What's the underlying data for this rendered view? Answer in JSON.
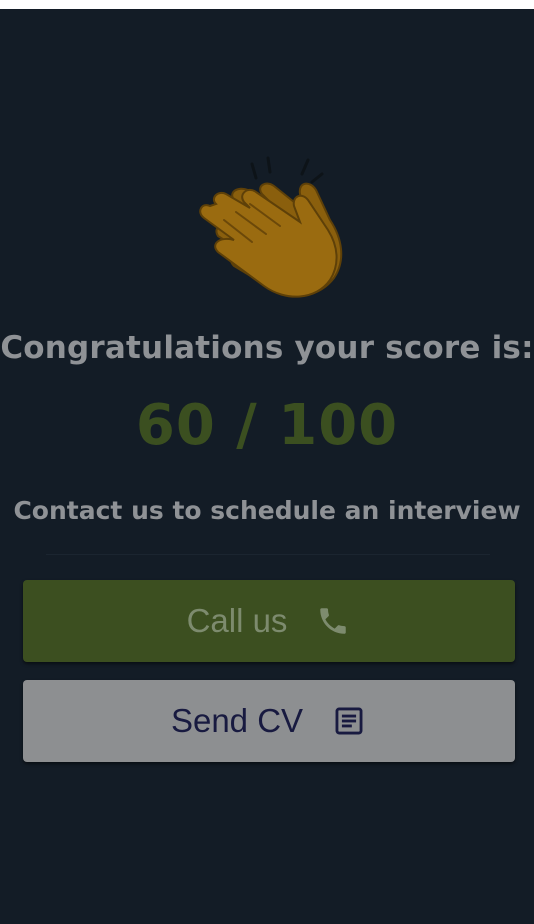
{
  "result": {
    "emoji_icon": "clapping-hands-icon",
    "headline": "Congratulations your score is:",
    "score": "60 / 100",
    "subline": "Contact us to schedule an interview"
  },
  "actions": {
    "call_label": "Call us",
    "call_icon": "phone-icon",
    "cv_label": "Send CV",
    "cv_icon": "document-icon"
  },
  "colors": {
    "background": "#131c26",
    "score": "#3b4f20",
    "call_button": "#3c4f20",
    "cv_button": "#8d8f91"
  }
}
